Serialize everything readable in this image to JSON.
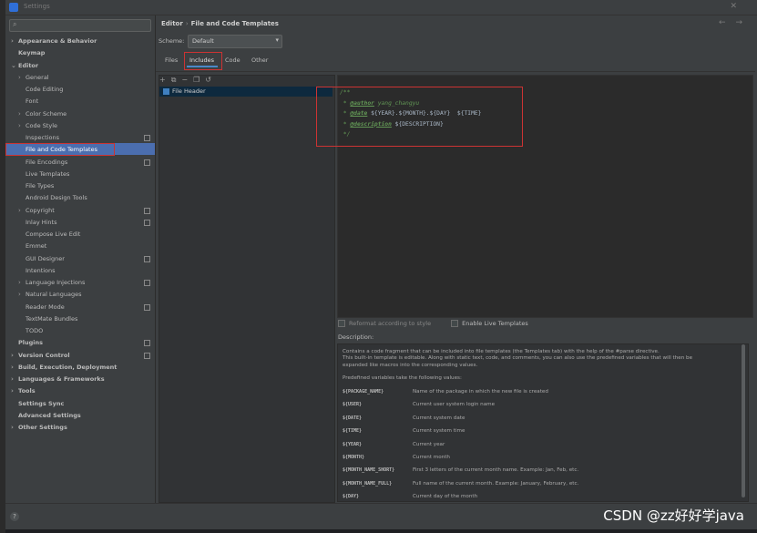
{
  "window": {
    "title": "Settings"
  },
  "search": {
    "placeholder": ""
  },
  "sidebar": {
    "items": [
      {
        "label": "Appearance & Behavior",
        "level": 0,
        "bold": true,
        "arrow": true
      },
      {
        "label": "Keymap",
        "level": 0,
        "bold": true,
        "arrow": false
      },
      {
        "label": "Editor",
        "level": 0,
        "bold": true,
        "arrow": true,
        "expanded": true
      },
      {
        "label": "General",
        "level": 1,
        "arrow": true
      },
      {
        "label": "Code Editing",
        "level": 1
      },
      {
        "label": "Font",
        "level": 1
      },
      {
        "label": "Color Scheme",
        "level": 1,
        "arrow": true
      },
      {
        "label": "Code Style",
        "level": 1,
        "arrow": true
      },
      {
        "label": "Inspections",
        "level": 1,
        "badge": true
      },
      {
        "label": "File and Code Templates",
        "level": 1,
        "selected": true
      },
      {
        "label": "File Encodings",
        "level": 1,
        "badge": true
      },
      {
        "label": "Live Templates",
        "level": 1
      },
      {
        "label": "File Types",
        "level": 1
      },
      {
        "label": "Android Design Tools",
        "level": 1
      },
      {
        "label": "Copyright",
        "level": 1,
        "arrow": true,
        "badge": true
      },
      {
        "label": "Inlay Hints",
        "level": 1,
        "badge": true
      },
      {
        "label": "Compose Live Edit",
        "level": 1
      },
      {
        "label": "Emmet",
        "level": 1
      },
      {
        "label": "GUI Designer",
        "level": 1,
        "badge": true
      },
      {
        "label": "Intentions",
        "level": 1
      },
      {
        "label": "Language Injections",
        "level": 1,
        "arrow": true,
        "badge": true
      },
      {
        "label": "Natural Languages",
        "level": 1,
        "arrow": true
      },
      {
        "label": "Reader Mode",
        "level": 1,
        "badge": true
      },
      {
        "label": "TextMate Bundles",
        "level": 1
      },
      {
        "label": "TODO",
        "level": 1
      },
      {
        "label": "Plugins",
        "level": 0,
        "bold": true,
        "badge": true
      },
      {
        "label": "Version Control",
        "level": 0,
        "bold": true,
        "arrow": true,
        "badge": true
      },
      {
        "label": "Build, Execution, Deployment",
        "level": 0,
        "bold": true,
        "arrow": true
      },
      {
        "label": "Languages & Frameworks",
        "level": 0,
        "bold": true,
        "arrow": true
      },
      {
        "label": "Tools",
        "level": 0,
        "bold": true,
        "arrow": true
      },
      {
        "label": "Settings Sync",
        "level": 0,
        "bold": true
      },
      {
        "label": "Advanced Settings",
        "level": 0,
        "bold": true
      },
      {
        "label": "Other Settings",
        "level": 0,
        "bold": true,
        "arrow": true
      }
    ]
  },
  "breadcrumb": {
    "part1": "Editor",
    "sep": "›",
    "part2": "File and Code Templates"
  },
  "nav": {
    "back": "←",
    "forward": "→"
  },
  "scheme": {
    "label": "Scheme:",
    "value": "Default"
  },
  "tabs": {
    "files": "Files",
    "includes": "Includes",
    "code": "Code",
    "other": "Other"
  },
  "toolbar": {
    "add": "+",
    "copy_icon": "⧉",
    "remove": "−",
    "duplicate": "❐",
    "reset": "↺"
  },
  "list": {
    "item": "File Header"
  },
  "code": {
    "l1": "/**",
    "l2_star": " * ",
    "l2_tag": "@author",
    "l2_val": " yang_changyu",
    "l3_star": " * ",
    "l3_tag": "@date",
    "l3_val": " ${YEAR}.${MONTH}.${DAY}  ${TIME}",
    "l4_star": " * ",
    "l4_tag": "@description",
    "l4_val": " ${DESCRIPTION}",
    "l5": " */"
  },
  "options": {
    "reformat": "Reformat according to style",
    "live": "Enable Live Templates"
  },
  "description": {
    "label": "Description:",
    "p1": "Contains a code fragment that can be included into file templates (the Templates tab) with the help of the #parse directive.",
    "p2": "This built-in template is editable. Along with static text, code, and comments, you can also use the predefined variables that will then be expanded like macros into the corresponding values.",
    "p3": "Predefined variables take the following values:",
    "vars": [
      {
        "name": "${PACKAGE_NAME}",
        "desc": "Name of the package in which the new file is created"
      },
      {
        "name": "${USER}",
        "desc": "Current user system login name"
      },
      {
        "name": "${DATE}",
        "desc": "Current system date"
      },
      {
        "name": "${TIME}",
        "desc": "Current system time"
      },
      {
        "name": "${YEAR}",
        "desc": "Current year"
      },
      {
        "name": "${MONTH}",
        "desc": "Current month"
      },
      {
        "name": "${MONTH_NAME_SHORT}",
        "desc": "First 3 letters of the current month name. Example: Jan, Feb, etc."
      },
      {
        "name": "${MONTH_NAME_FULL}",
        "desc": "Full name of the current month. Example: January, February, etc."
      },
      {
        "name": "${DAY}",
        "desc": "Current day of the month"
      }
    ]
  },
  "footer": {
    "help": "?"
  },
  "watermark": "CSDN @zz好好学java",
  "colors": {
    "selection": "#4b6eaf",
    "accent": "#4a88c7",
    "highlight_box": "#cc3333",
    "comment": "#629755"
  }
}
